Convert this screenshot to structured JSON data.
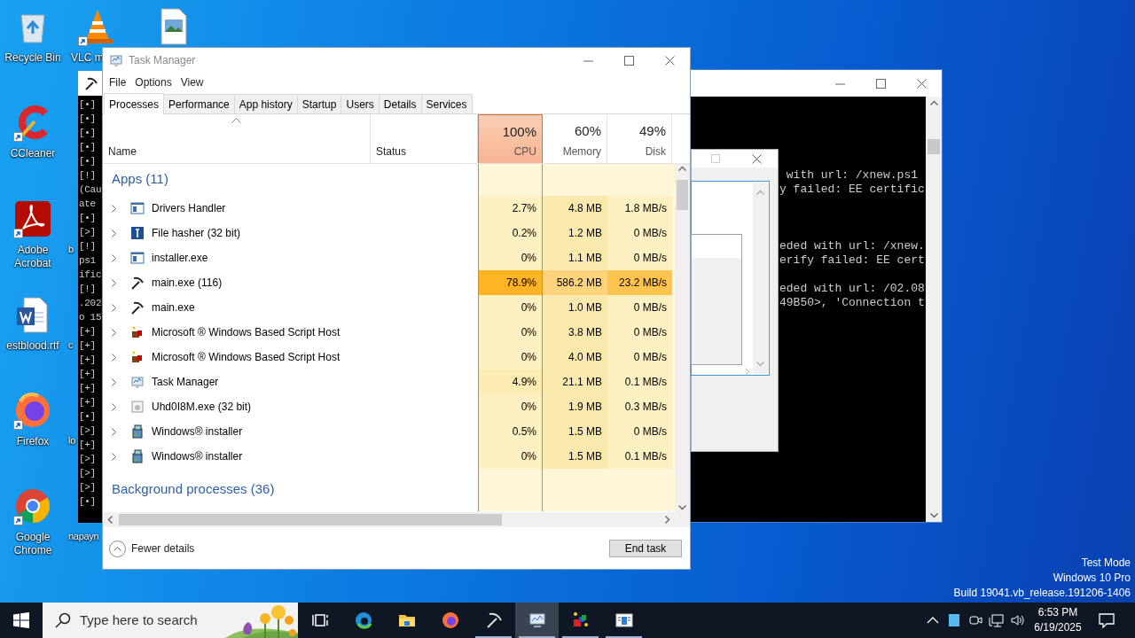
{
  "desktop": {
    "icons": [
      {
        "label": "Recycle Bin",
        "kind": "recycle-bin",
        "shortcut": false
      },
      {
        "label": "CCleaner",
        "kind": "cleaner",
        "shortcut": true
      },
      {
        "label": "Adobe Acrobat",
        "kind": "pdf",
        "shortcut": true
      },
      {
        "label": "estblood.rtf",
        "kind": "document",
        "shortcut": false
      },
      {
        "label": "Firefox",
        "kind": "firefox",
        "shortcut": true
      },
      {
        "label": "Google Chrome",
        "kind": "chrome",
        "shortcut": true
      },
      {
        "label": "VLC m",
        "kind": "cone",
        "shortcut": true
      },
      {
        "kind": "image-file",
        "shortcut": false
      }
    ],
    "partial_labels": [
      "b",
      "c",
      "lo",
      "napayn"
    ],
    "system_notice": [
      "Test Mode",
      "Windows 10 Pro",
      "Build 19041.vb_release.191206-1406"
    ]
  },
  "console_left": {
    "lines": [
      "[•]",
      "[•]",
      "[•]",
      "[•]",
      "[•]",
      "[!]",
      "(Cau",
      "ate",
      "[•]",
      "[>]",
      "[!]",
      "ps1",
      "ific",
      "[!]",
      ".202",
      "o 15",
      "[+]",
      "[+]",
      "[+]",
      "[+]",
      "[+]",
      "[+]",
      "[•]",
      "[>]",
      "[+]",
      "[>]",
      "[>]",
      "[>]",
      "[•]"
    ]
  },
  "console_right": {
    "blocks": [
      [
        " with url: /xnew.ps1",
        "y failed: EE certific"
      ],
      [
        "eded with url: /xnew.",
        "erify failed: EE cert"
      ],
      [
        "eded with url: /02.08",
        "49B50>, 'Connection t"
      ]
    ]
  },
  "task_manager": {
    "title": "Task Manager",
    "menu": [
      "File",
      "Options",
      "View"
    ],
    "tabs": [
      {
        "label": "Processes",
        "selected": true
      },
      {
        "label": "Performance",
        "selected": false
      },
      {
        "label": "App history",
        "selected": false
      },
      {
        "label": "Startup",
        "selected": false
      },
      {
        "label": "Users",
        "selected": false
      },
      {
        "label": "Details",
        "selected": false
      },
      {
        "label": "Services",
        "selected": false
      }
    ],
    "columns": [
      {
        "label": "Name",
        "sorted": true,
        "highlighted": false
      },
      {
        "label": "Status",
        "sorted": false,
        "highlighted": false
      },
      {
        "percent": "100%",
        "label": "CPU",
        "sorted": false,
        "highlighted": true
      },
      {
        "percent": "60%",
        "label": "Memory",
        "sorted": false,
        "highlighted": false
      },
      {
        "percent": "49%",
        "label": "Disk",
        "sorted": false,
        "highlighted": false
      }
    ],
    "groups": [
      {
        "title": "Apps (11)",
        "rows": [
          {
            "name": "Drivers Handler",
            "kind": "window",
            "expanded": false,
            "cells": [
              {
                "text": "2.7%",
                "color": "#fdf0c2"
              },
              {
                "text": "4.8 MB",
                "color": "#fae9ad"
              },
              {
                "text": "1.8 MB/s",
                "color": "#fdf0c2"
              }
            ]
          },
          {
            "name": "File hasher (32 bit)",
            "kind": "hasher",
            "expanded": false,
            "cells": [
              {
                "text": "0.2%",
                "color": "#fdf0c2"
              },
              {
                "text": "1.2 MB",
                "color": "#fae9ad"
              },
              {
                "text": "0 MB/s",
                "color": "#fdf0c2"
              }
            ]
          },
          {
            "name": "installer.exe",
            "kind": "window",
            "expanded": false,
            "cells": [
              {
                "text": "0%",
                "color": "#fdf0c2"
              },
              {
                "text": "1.1 MB",
                "color": "#fae9ad"
              },
              {
                "text": "0 MB/s",
                "color": "#fdf0c2"
              }
            ]
          },
          {
            "name": "main.exe (116)",
            "kind": "pickaxe",
            "expanded": false,
            "cells": [
              {
                "text": "78.9%",
                "color": "#ffb424"
              },
              {
                "text": "586.2 MB",
                "color": "#fdd47c"
              },
              {
                "text": "23.2 MB/s",
                "color": "#ffc44d"
              }
            ]
          },
          {
            "name": "main.exe",
            "kind": "pickaxe",
            "expanded": false,
            "cells": [
              {
                "text": "0%",
                "color": "#fdf0c2"
              },
              {
                "text": "1.0 MB",
                "color": "#fae9ad"
              },
              {
                "text": "0 MB/s",
                "color": "#fdf0c2"
              }
            ]
          },
          {
            "name": "Microsoft ® Windows Based Script Host",
            "kind": "cube",
            "expanded": false,
            "cells": [
              {
                "text": "0%",
                "color": "#fdf0c2"
              },
              {
                "text": "3.8 MB",
                "color": "#fae9ad"
              },
              {
                "text": "0 MB/s",
                "color": "#fdf0c2"
              }
            ]
          },
          {
            "name": "Microsoft ® Windows Based Script Host",
            "kind": "cube",
            "expanded": false,
            "cells": [
              {
                "text": "0%",
                "color": "#fdf0c2"
              },
              {
                "text": "4.0 MB",
                "color": "#fae9ad"
              },
              {
                "text": "0 MB/s",
                "color": "#fdf0c2"
              }
            ]
          },
          {
            "name": "Task Manager",
            "kind": "monitor",
            "expanded": false,
            "cells": [
              {
                "text": "4.9%",
                "color": "#fcecb4"
              },
              {
                "text": "21.1 MB",
                "color": "#fae9ad"
              },
              {
                "text": "0.1 MB/s",
                "color": "#fdf0c2"
              }
            ]
          },
          {
            "name": "Uhd0I8M.exe (32 bit)",
            "kind": "program",
            "expanded": false,
            "cells": [
              {
                "text": "0%",
                "color": "#fdf0c2"
              },
              {
                "text": "1.9 MB",
                "color": "#fae9ad"
              },
              {
                "text": "0.3 MB/s",
                "color": "#fdf0c2"
              }
            ]
          },
          {
            "name": "Windows® installer",
            "kind": "package",
            "expanded": false,
            "cells": [
              {
                "text": "0.5%",
                "color": "#fdf0c2"
              },
              {
                "text": "1.5 MB",
                "color": "#fae9ad"
              },
              {
                "text": "0 MB/s",
                "color": "#fdf0c2"
              }
            ]
          },
          {
            "name": "Windows® installer",
            "kind": "package",
            "expanded": false,
            "cells": [
              {
                "text": "0%",
                "color": "#fdf0c2"
              },
              {
                "text": "1.5 MB",
                "color": "#fae9ad"
              },
              {
                "text": "0.1 MB/s",
                "color": "#fdf0c2"
              }
            ]
          }
        ]
      },
      {
        "title": "Background processes (36)"
      }
    ],
    "footer": {
      "toggle": "Fewer details",
      "end_task": "End task"
    }
  },
  "taskbar": {
    "search_placeholder": "Type here to search",
    "apps": [
      {
        "kind": "task-view",
        "running": false,
        "active": false
      },
      {
        "kind": "edge",
        "running": false,
        "active": false
      },
      {
        "kind": "folder",
        "running": false,
        "active": false
      },
      {
        "kind": "firefox",
        "running": false,
        "active": false
      },
      {
        "kind": "pickaxe",
        "running": true,
        "active": false
      },
      {
        "kind": "monitor",
        "running": true,
        "active": true
      },
      {
        "kind": "cubes",
        "running": true,
        "active": false
      },
      {
        "kind": "window",
        "running": true,
        "active": false
      }
    ],
    "time": "6:53 PM",
    "date": "6/19/2025"
  }
}
